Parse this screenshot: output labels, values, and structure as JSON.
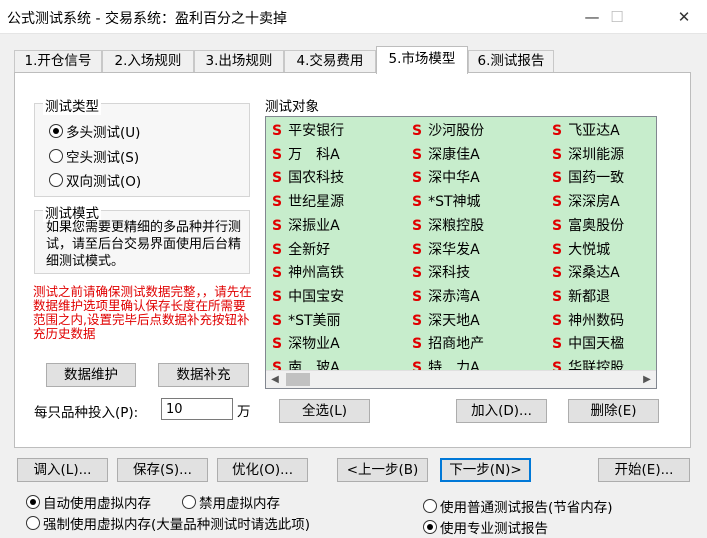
{
  "window": {
    "title": "公式测试系统 - 交易系统：盈利百分之十卖掉",
    "minimize": "—",
    "maximize": "☐",
    "close": "✕"
  },
  "tabs": [
    "1.开仓信号",
    "2.入场规则",
    "3.出场规则",
    "4.交易费用",
    "5.市场模型",
    "6.测试报告"
  ],
  "test_type": {
    "label": "测试类型",
    "options": [
      "多头测试(U)",
      "空头测试(S)",
      "双向测试(O)"
    ],
    "selected": 0
  },
  "test_mode": {
    "label": "测试模式",
    "text": "如果您需要更精细的多品种并行测试，请至后台交易界面使用后台精细测试模式。"
  },
  "warning": "测试之前请确保测试数据完整，，请先在数据维护选项里确认保存长度在所需要范围之内,设置完毕后点数据补充按钮补充历史数据",
  "buttons": {
    "data_maintain": "数据维护",
    "data_supplement": "数据补充",
    "select_all": "全选(L)",
    "add": "加入(D)...",
    "delete": "删除(E)",
    "import": "调入(L)...",
    "save": "保存(S)...",
    "optimize": "优化(O)...",
    "prev": "<上一步(B)",
    "next": "下一步(N)>",
    "start": "开始(E)..."
  },
  "invest": {
    "label": "每只品种投入(P):",
    "value": "10",
    "unit": "万"
  },
  "targets": {
    "label": "测试对象",
    "marker": "S",
    "items": [
      [
        "平安银行",
        "沙河股份",
        "飞亚达A"
      ],
      [
        "万　科A",
        "深康佳A",
        "深圳能源"
      ],
      [
        "国农科技",
        "深中华A",
        "国药一致"
      ],
      [
        "世纪星源",
        "*ST神城",
        "深深房A"
      ],
      [
        "深振业A",
        "深粮控股",
        "富奥股份"
      ],
      [
        "全新好",
        "深华发A",
        "大悦城"
      ],
      [
        "神州高铁",
        "深科技",
        "深桑达A"
      ],
      [
        "中国宝安",
        "深赤湾A",
        "新都退"
      ],
      [
        "*ST美丽",
        "深天地A",
        "神州数码"
      ],
      [
        "深物业A",
        "招商地产",
        "中国天楹"
      ],
      [
        "南　玻A",
        "特　力A",
        "华联控股"
      ]
    ]
  },
  "memory": {
    "options": [
      "自动使用虚拟内存",
      "禁用虚拟内存",
      "强制使用虚拟内存(大量品种测试时请选此项)"
    ],
    "selected": 0
  },
  "report": {
    "options": [
      "使用普通测试报告(节省内存)",
      "使用专业测试报告"
    ],
    "selected": 1
  }
}
